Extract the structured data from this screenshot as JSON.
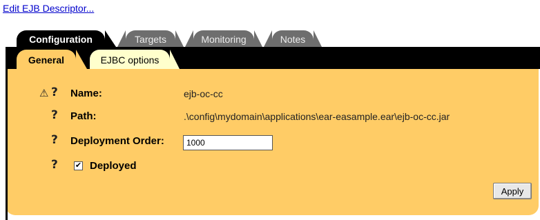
{
  "edit_link": "Edit EJB Descriptor...",
  "tabs": [
    {
      "label": "Configuration",
      "active": true
    },
    {
      "label": "Targets",
      "active": false
    },
    {
      "label": "Monitoring",
      "active": false
    },
    {
      "label": "Notes",
      "active": false
    }
  ],
  "subtabs": [
    {
      "label": "General",
      "active": true
    },
    {
      "label": "EJBC options",
      "active": false
    }
  ],
  "form": {
    "name_label": "Name:",
    "name_value": "ejb-oc-cc",
    "path_label": "Path:",
    "path_value": ".\\config\\mydomain\\applications\\ear-easample.ear\\ejb-oc-cc.jar",
    "order_label": "Deployment Order:",
    "order_value": "1000",
    "deployed_label": "Deployed",
    "deployed_checked": true,
    "help_glyph": "?",
    "warning_glyph": "⚠"
  },
  "apply_label": "Apply",
  "colors": {
    "panel": "#ffcc66",
    "subtab_inactive": "#ffffcc",
    "tab_inactive": "#6e6e6e",
    "tab_active": "#000000",
    "link": "#0000cc"
  }
}
